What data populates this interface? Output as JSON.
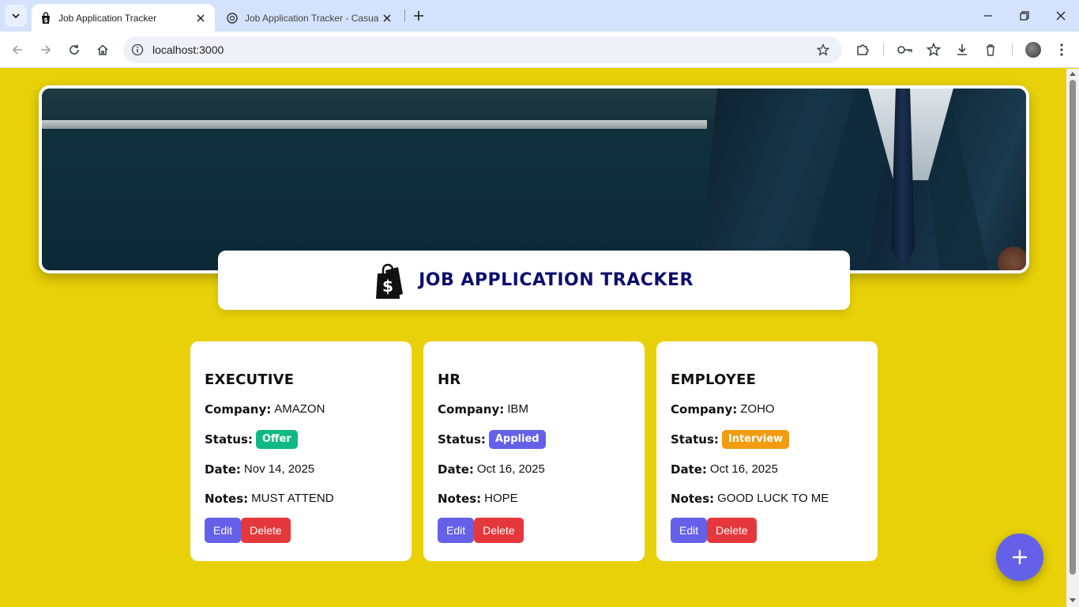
{
  "browser": {
    "tabs": [
      {
        "title": "Job Application Tracker",
        "favicon": "shopping-bag-dollar-icon"
      },
      {
        "title": "Job Application Tracker - Casual",
        "favicon": "openai-icon"
      }
    ],
    "url": "localhost:3000"
  },
  "header": {
    "title": "JOB APPLICATION TRACKER",
    "logo": "dollar-shopping-bag-icon"
  },
  "applications": [
    {
      "role": "EXECUTIVE",
      "company_label": "Company:",
      "company": "AMAZON",
      "status_label": "Status:",
      "status": "Offer",
      "status_color": "#10b981",
      "date_label": "Date:",
      "date": "Nov 14, 2025",
      "notes_label": "Notes:",
      "notes": "MUST ATTEND",
      "edit_label": "Edit",
      "delete_label": "Delete"
    },
    {
      "role": "HR",
      "company_label": "Company:",
      "company": "IBM",
      "status_label": "Status:",
      "status": "Applied",
      "status_color": "#6461e8",
      "date_label": "Date:",
      "date": "Oct 16, 2025",
      "notes_label": "Notes:",
      "notes": "HOPE",
      "edit_label": "Edit",
      "delete_label": "Delete"
    },
    {
      "role": "EMPLOYEE",
      "company_label": "Company:",
      "company": "ZOHO",
      "status_label": "Status:",
      "status": "Interview",
      "status_color": "#f39c12",
      "date_label": "Date:",
      "date": "Oct 16, 2025",
      "notes_label": "Notes:",
      "notes": "GOOD LUCK TO ME",
      "edit_label": "Edit",
      "delete_label": "Delete"
    }
  ],
  "fab": {
    "icon": "plus-icon"
  },
  "colors": {
    "page_background": "#e8d108",
    "title_color": "#0c0e6e",
    "edit_button": "#6461e8",
    "delete_button": "#e5383c"
  }
}
